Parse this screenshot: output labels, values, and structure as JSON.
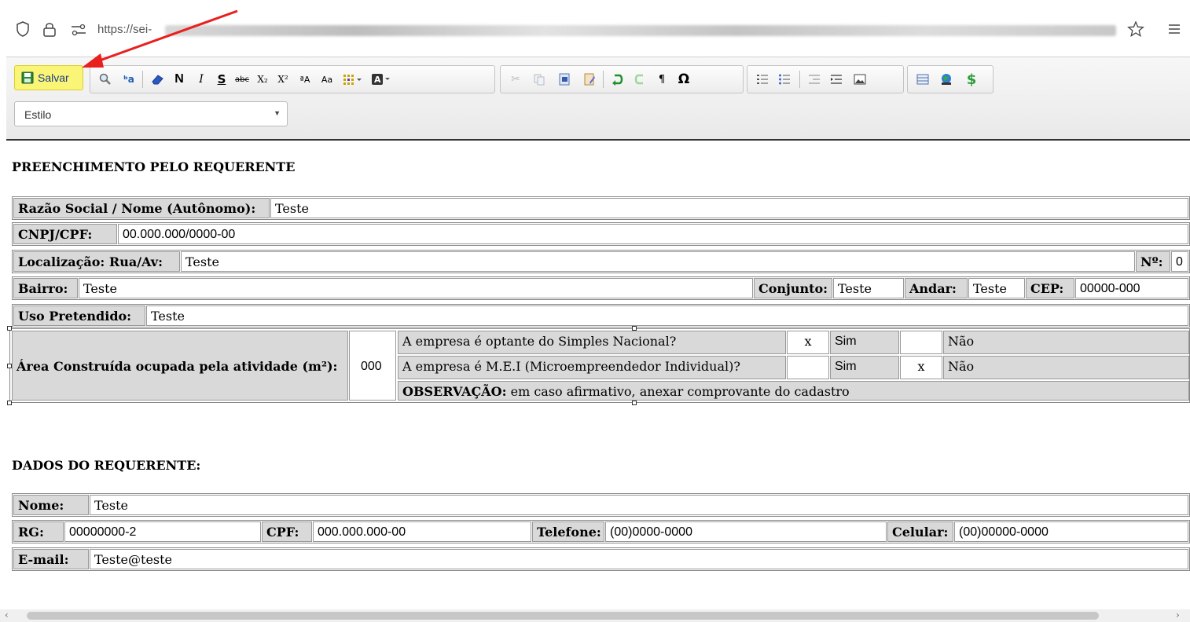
{
  "browser": {
    "url_prefix": "https://sei-",
    "icons": [
      "shield-icon",
      "lock-icon",
      "permissions-icon",
      "star-icon",
      "menu-icon"
    ]
  },
  "toolbar": {
    "save_label": "Salvar",
    "style_select": "Estilo",
    "buttons": [
      "N",
      "I",
      "S",
      "abc",
      "X₂",
      "X²",
      "Ω",
      "¶"
    ]
  },
  "document": {
    "section1_title": "PREENCHIMENTO PELO REQUERENTE",
    "razao_label": "Razão Social / Nome (Autônomo):",
    "razao_value": "Teste",
    "cnpj_label": "CNPJ/CPF:",
    "cnpj_value": "00.000.000/0000-00",
    "local_label": "Localização: Rua/Av:",
    "local_value": "Teste",
    "num_label": "Nº:",
    "num_value": "0",
    "bairro_label": "Bairro:",
    "bairro_value": "Teste",
    "conjunto_label": "Conjunto:",
    "conjunto_value": "Teste",
    "andar_label": "Andar:",
    "andar_value": "Teste",
    "cep_label": "CEP:",
    "cep_value": "00000-000",
    "uso_label": "Uso Pretendido:",
    "uso_value": "Teste",
    "area_label": "Área Construída ocupada pela atividade (m²):",
    "area_value": "000",
    "q1": "A empresa é optante do Simples Nacional?",
    "q1_sim_mark": "x",
    "q1_sim": "Sim",
    "q1_nao_mark": "",
    "q1_nao": "Não",
    "q2": "A empresa é M.E.I (Microempreendedor Individual)?",
    "q2_sim_mark": "",
    "q2_sim": "Sim",
    "q2_nao_mark": "x",
    "q2_nao": "Não",
    "obs_bold": "OBSERVAÇÃO:",
    "obs_text": " em caso afirmativo, anexar comprovante do cadastro",
    "section2_title": "DADOS DO REQUERENTE:",
    "nome_label": "Nome:",
    "nome_value": "Teste",
    "rg_label": "RG:",
    "rg_value": "00000000-2",
    "cpf_label": "CPF:",
    "cpf_value": "000.000.000-00",
    "tel_label": "Telefone:",
    "tel_value": "(00)0000-0000",
    "cel_label": "Celular:",
    "cel_value": "(00)00000-0000",
    "email_label": "E-mail:",
    "email_value": "Teste@teste"
  }
}
